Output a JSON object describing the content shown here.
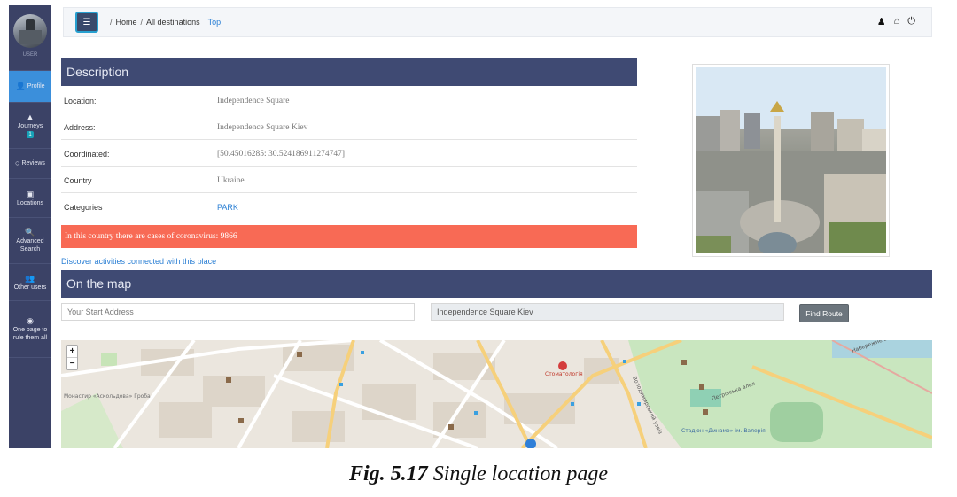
{
  "sidebar": {
    "user_label": "USER",
    "items": [
      {
        "icon": "👤",
        "label": "Profile"
      },
      {
        "icon": "▲",
        "label": "Journeys",
        "badge": "1"
      },
      {
        "icon": "○",
        "label": "Reviews"
      },
      {
        "icon": "▣",
        "label": "Locations"
      },
      {
        "icon": "🔍",
        "label": "Advanced Search"
      },
      {
        "icon": "👥",
        "label": "Other users"
      },
      {
        "icon": "◉",
        "label": "One page to rule them all"
      }
    ]
  },
  "topbar": {
    "breadcrumb": [
      "Home",
      "All destinations"
    ],
    "breadcrumb_link": "Top",
    "icons": [
      "user-icon",
      "home-icon",
      "power-icon"
    ]
  },
  "description": {
    "title": "Description",
    "rows": [
      {
        "key": "Location:",
        "value": "Independence Square"
      },
      {
        "key": "Address:",
        "value": "Independence Square Kiev"
      },
      {
        "key": "Coordinated:",
        "value": "[50.45016285: 30.524186911274747]"
      },
      {
        "key": "Country",
        "value": "Ukraine"
      },
      {
        "key": "Categories",
        "value": "PARK"
      }
    ],
    "alert": "In this country there are cases of coronavirus: 9866",
    "discover_link": "Discover activities connected with this place"
  },
  "map_section": {
    "title": "On the map",
    "start_placeholder": "Your Start Address",
    "destination_value": "Independence Square Kiev",
    "find_route_label": "Find Route",
    "zoom_in": "+",
    "zoom_out": "−",
    "labels": [
      "Стоматологія",
      "Стадіон «Динамо» ім. Валерія",
      "Монастир «Аскольдова» Гроба",
      "Володимирський узвіз",
      "Петрівська алея",
      "Набережне шосе"
    ]
  },
  "caption": {
    "bold": "Fig. 5.17",
    "text": "Single location page"
  },
  "colors": {
    "sidebar": "#3b4266",
    "header": "#3f4a73",
    "alert": "#f86a55",
    "link": "#2a7fd4",
    "active": "#3b8fdb"
  }
}
